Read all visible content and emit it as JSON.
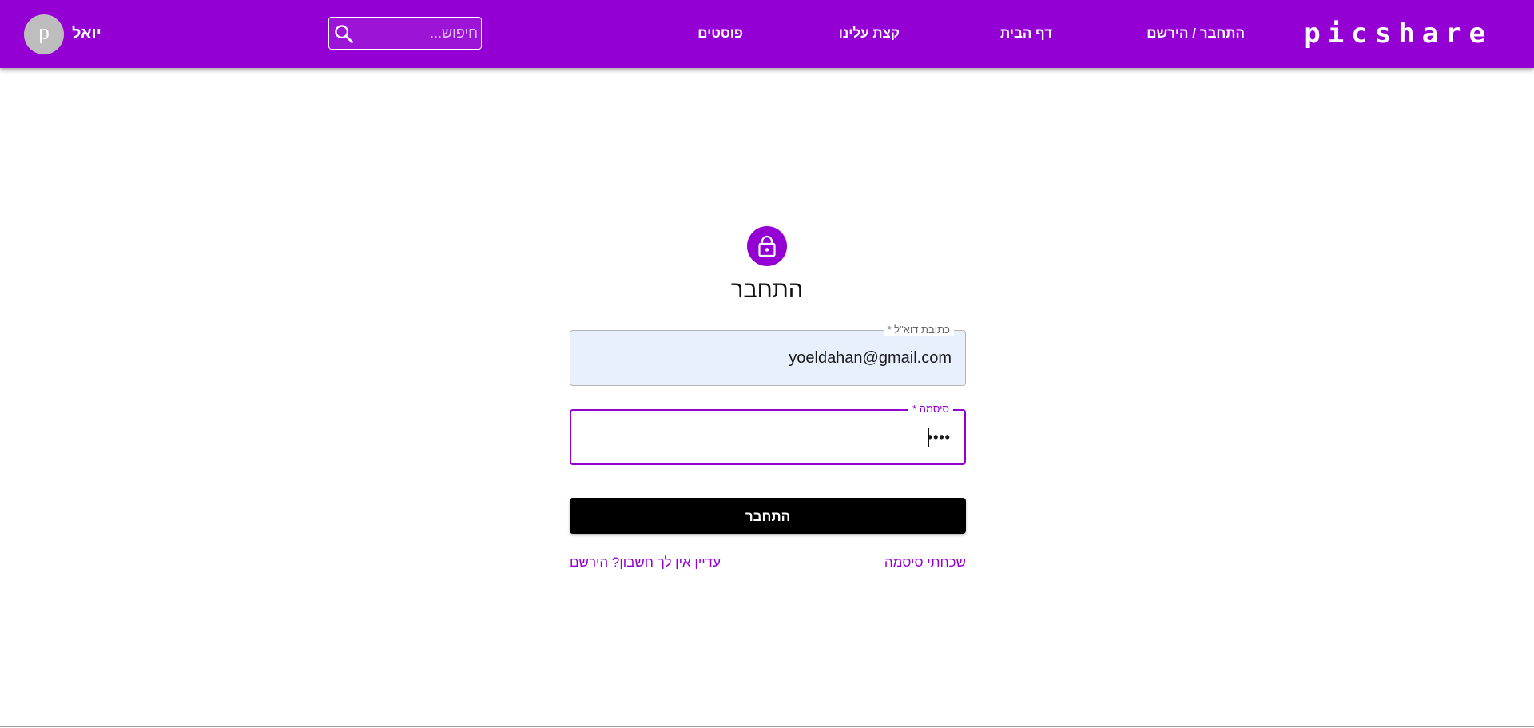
{
  "theme": {
    "primary": "#9400d3",
    "button_bg": "#000000",
    "autofill_bg": "#e8f0fe"
  },
  "header": {
    "brand": "picshare",
    "nav": {
      "login_register": "התחבר / הירשם",
      "home": "דף הבית",
      "about": "קצת עלינו",
      "posts": "פוסטים"
    },
    "search": {
      "placeholder": "חיפוש...",
      "icon": "search-icon"
    },
    "user": {
      "name": "יואל",
      "avatar_letter": "p"
    }
  },
  "login": {
    "icon": "lock-icon",
    "title": "התחבר",
    "email": {
      "label": "כתובת דוא\"ל *",
      "value": "yoeldahan@gmail.com"
    },
    "password": {
      "label": "סיסמה *",
      "masked_value": "••••"
    },
    "submit_label": "התחבר",
    "forgot_password": "שכחתי סיסמה",
    "register_prompt": "עדיין אין לך חשבון? הירשם"
  }
}
